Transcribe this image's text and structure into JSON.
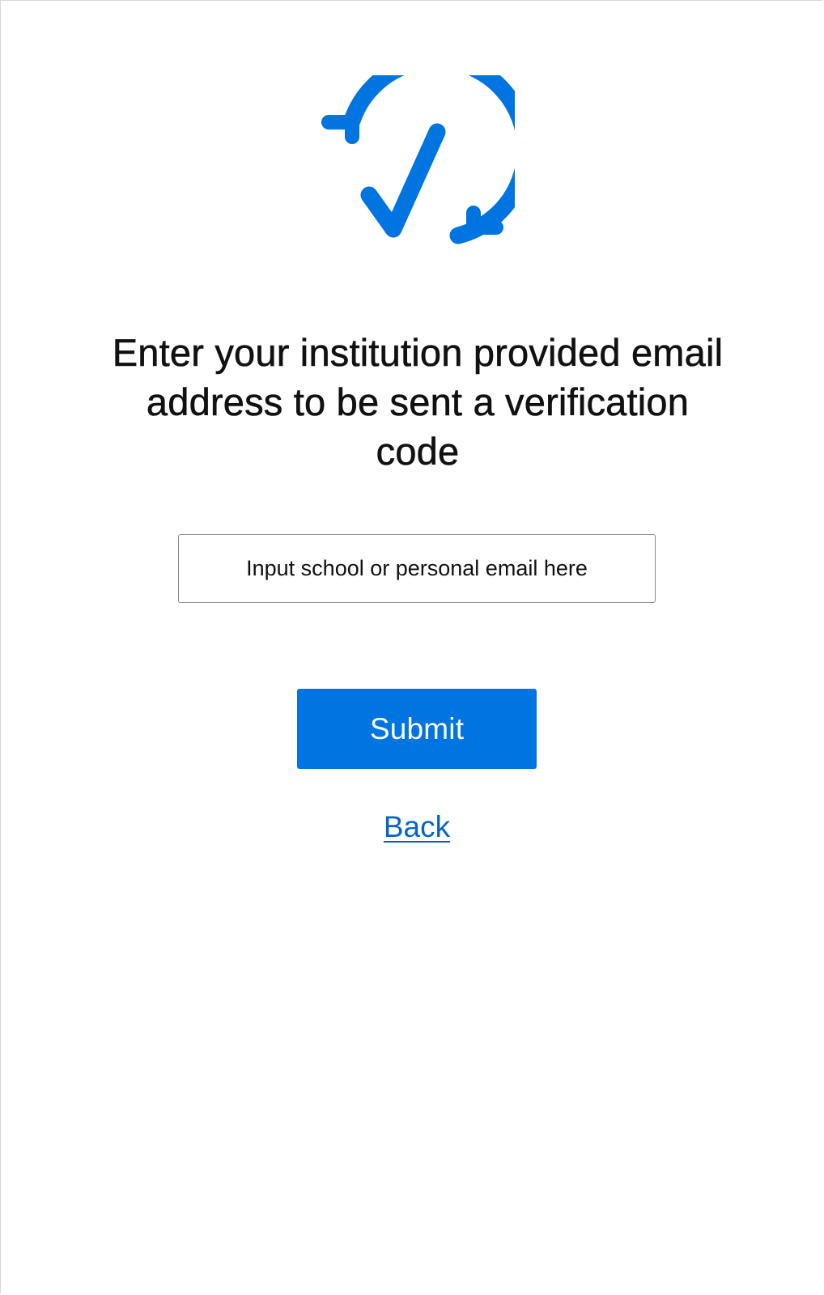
{
  "branding": {
    "logo_icon": "refresh-checkmark-icon",
    "accent_color": "#0074e0"
  },
  "main": {
    "heading": "Enter your institution provided email address to be sent a verification code",
    "email_input": {
      "placeholder": "Input school or personal email here",
      "value": ""
    },
    "submit_label": "Submit",
    "back_label": "Back"
  }
}
